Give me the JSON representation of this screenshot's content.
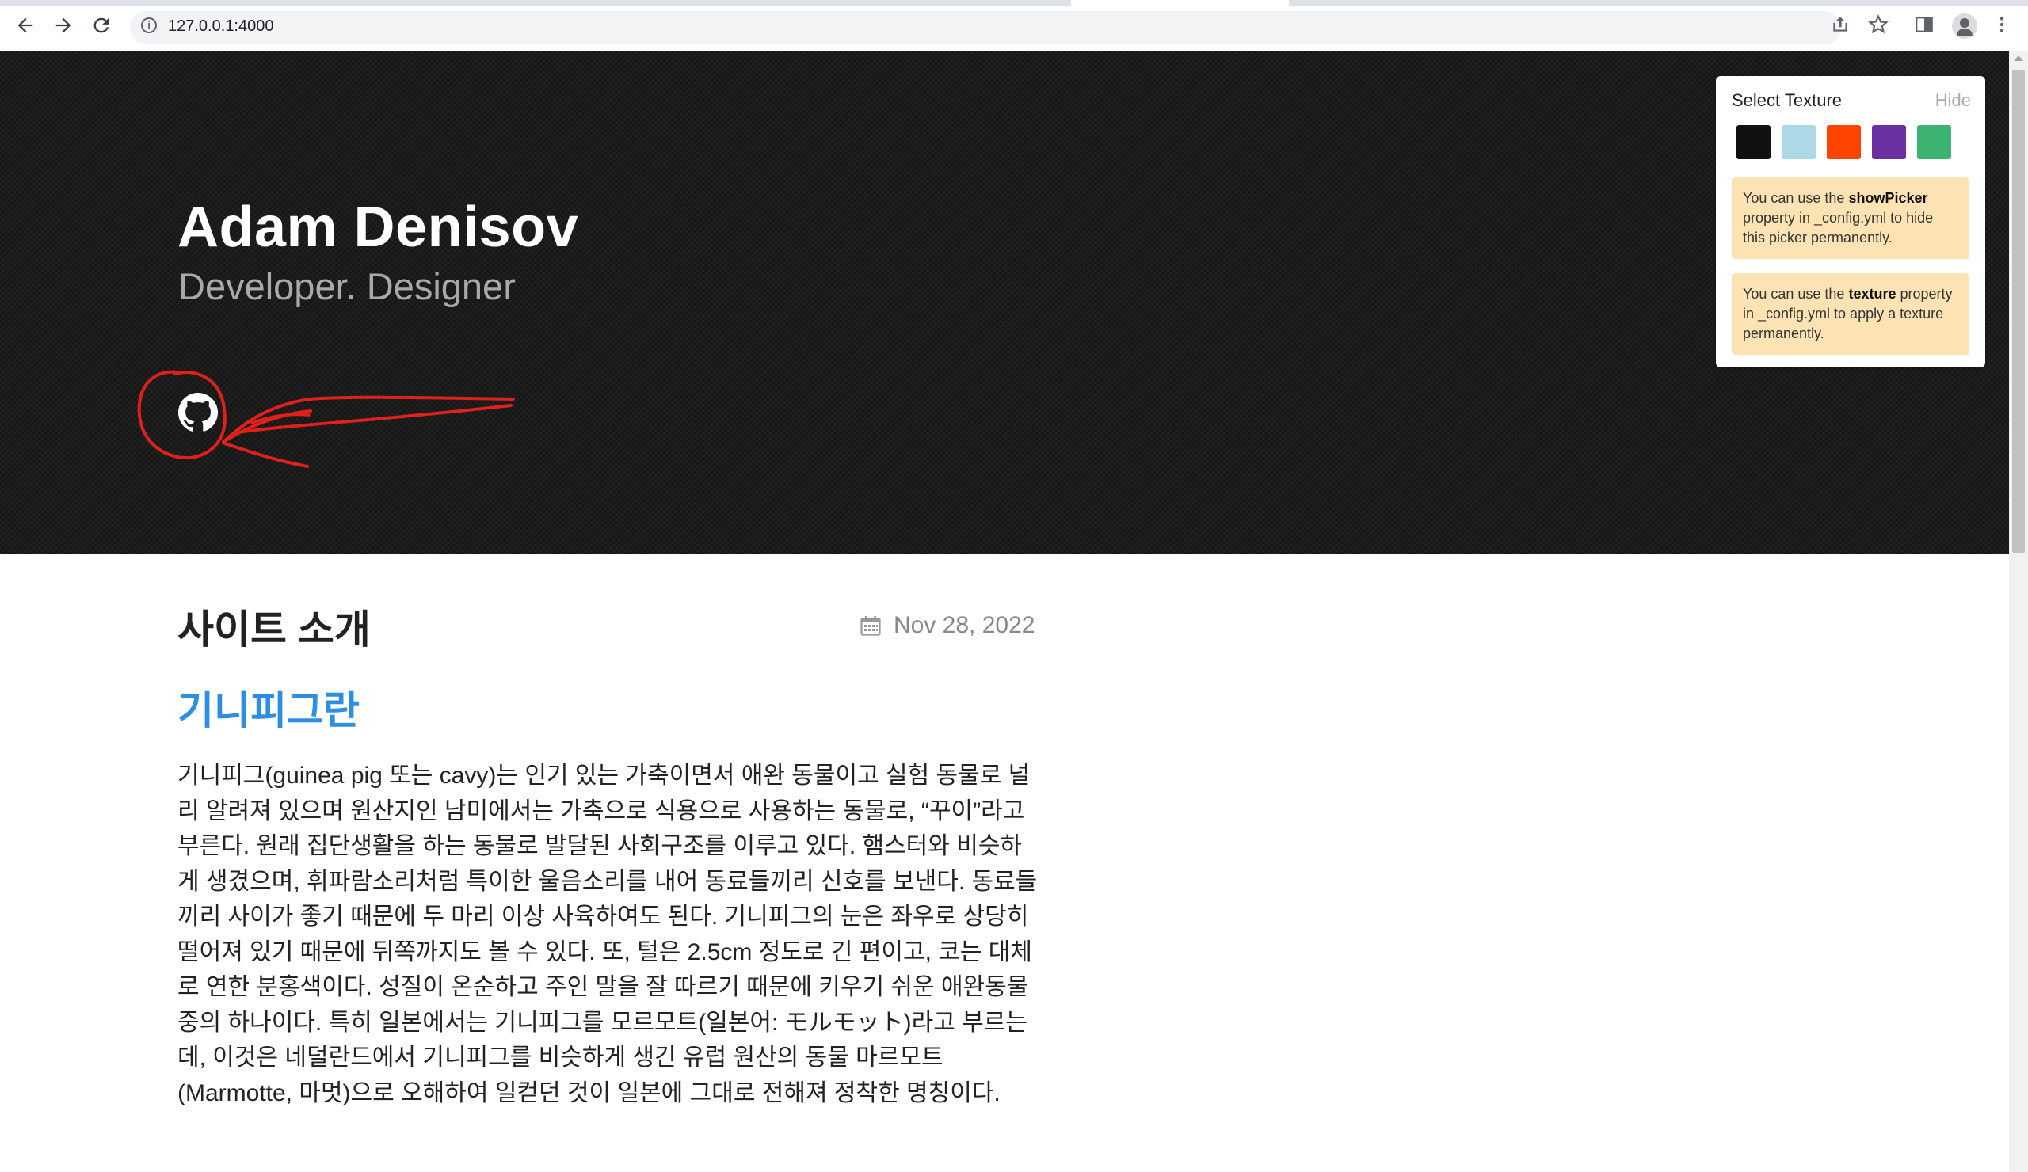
{
  "browser": {
    "url": "127.0.0.1:4000",
    "icons": [
      "back-arrow-icon",
      "forward-arrow-icon",
      "reload-icon",
      "info-icon",
      "share-icon",
      "star-icon",
      "side-panel-icon",
      "profile-icon",
      "kebab-menu-icon"
    ]
  },
  "header": {
    "title": "Adam Denisov",
    "subtitle": "Developer. Designer",
    "social_icon": "github-icon",
    "background": "#1c1c1c",
    "annotation_color": "#e0201a"
  },
  "picker": {
    "title": "Select Texture",
    "hide_label": "Hide",
    "swatches": [
      "#111111",
      "#add8e6",
      "#ff4500",
      "#6a2fa0",
      "#3cb371"
    ],
    "note1": {
      "prefix": "You can use the ",
      "keyword": "showPicker",
      "suffix": " property in _config.yml to hide this picker permanently."
    },
    "note2": {
      "prefix": "You can use the ",
      "keyword": "texture",
      "suffix": " property in _config.yml to apply a texture permanently."
    },
    "note_background": "#fde3b3"
  },
  "post": {
    "title": "사이트 소개",
    "date": "Nov 28, 2022",
    "date_icon": "calendar-icon",
    "section_heading": "기니피그란",
    "heading_color": "#2e8fe0",
    "body": "기니피그(guinea pig 또는 cavy)는 인기 있는 가축이면서 애완 동물이고 실험 동물로 널리 알려져 있으며 원산지인 남미에서는 가축으로 식용으로 사용하는 동물로, “꾸이”라고 부른다. 원래 집단생활을 하는 동물로 발달된 사회구조를 이루고 있다. 햄스터와 비슷하게 생겼으며, 휘파람소리처럼 특이한 울음소리를 내어 동료들끼리 신호를 보낸다. 동료들끼리 사이가 좋기 때문에 두 마리 이상 사육하여도 된다. 기니피그의 눈은 좌우로 상당히 떨어져 있기 때문에 뒤쪽까지도 볼 수 있다. 또, 털은 2.5cm 정도로 긴 편이고, 코는 대체로 연한 분홍색이다. 성질이 온순하고 주인 말을 잘 따르기 때문에 키우기 쉬운 애완동물 중의 하나이다. 특히 일본에서는 기니피그를 모르모트(일본어: モルモット)라고 부르는데, 이것은 네덜란드에서 기니피그를 비슷하게 생긴 유럽 원산의 동물 마르모트(Marmotte, 마멋)으로 오해하여 일컫던 것이 일본에 그대로 전해져 정착한 명칭이다."
  }
}
